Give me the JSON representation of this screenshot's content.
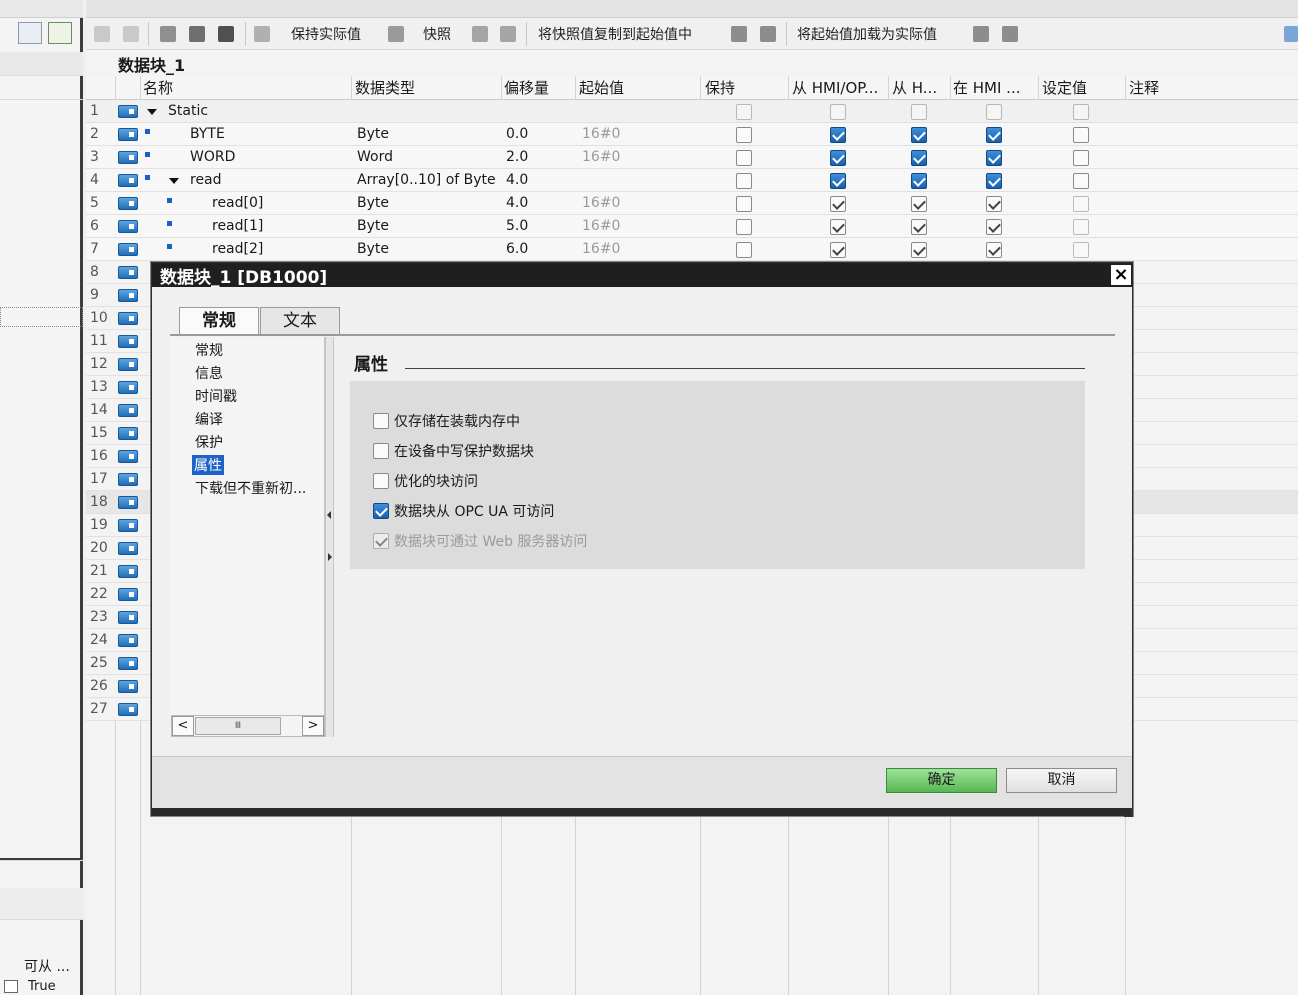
{
  "left_panel": {
    "column_label": "可从 ...",
    "value": "True"
  },
  "toolbar": {
    "keep_actual": "保持实际值",
    "snapshot": "快照",
    "copy_snapshot": "将快照值复制到起始值中",
    "load_start": "将起始值加载为实际值"
  },
  "block": {
    "title": "数据块_1"
  },
  "columns": [
    "名称",
    "数据类型",
    "偏移量",
    "起始值",
    "保持",
    "从 HMI/OP...",
    "从 H...",
    "在 HMI ...",
    "设定值",
    "注释"
  ],
  "rows": [
    {
      "num": "1",
      "name": "Static",
      "type": "",
      "offset": "",
      "start": ""
    },
    {
      "num": "2",
      "name": "BYTE",
      "type": "Byte",
      "offset": "0.0",
      "start": "16#0"
    },
    {
      "num": "3",
      "name": "WORD",
      "type": "Word",
      "offset": "2.0",
      "start": "16#0"
    },
    {
      "num": "4",
      "name": "read",
      "type": "Array[0..10] of Byte",
      "offset": "4.0",
      "start": ""
    },
    {
      "num": "5",
      "name": "read[0]",
      "type": "Byte",
      "offset": "4.0",
      "start": "16#0"
    },
    {
      "num": "6",
      "name": "read[1]",
      "type": "Byte",
      "offset": "5.0",
      "start": "16#0"
    },
    {
      "num": "7",
      "name": "read[2]",
      "type": "Byte",
      "offset": "6.0",
      "start": "16#0"
    }
  ],
  "more_rows": [
    "8",
    "9",
    "10",
    "11",
    "12",
    "13",
    "14",
    "15",
    "16",
    "17",
    "18",
    "19",
    "20",
    "21",
    "22",
    "23",
    "24",
    "25",
    "26",
    "27"
  ],
  "dialog": {
    "title": "数据块_1 [DB1000]",
    "close": "×",
    "tabs": [
      "常规",
      "文本"
    ],
    "nav": [
      "常规",
      "信息",
      "时间戳",
      "编译",
      "保护",
      "属性",
      "下载但不重新初..."
    ],
    "section_heading": "属性",
    "options": [
      {
        "label": "仅存储在装载内存中",
        "checked": false,
        "enabled": true
      },
      {
        "label": "在设备中写保护数据块",
        "checked": false,
        "enabled": true
      },
      {
        "label": "优化的块访问",
        "checked": false,
        "enabled": true
      },
      {
        "label": "数据块从 OPC UA 可访问",
        "checked": true,
        "enabled": true
      },
      {
        "label": "数据块可通过 Web 服务器访问",
        "checked": true,
        "enabled": false
      }
    ],
    "scroll_left": "<",
    "scroll_right": ">",
    "scroll_thumb": "Ⅲ",
    "ok": "确定",
    "cancel": "取消"
  },
  "colors": {
    "ok_button": "#57b652",
    "checkbox_checked": "#1a5fb0",
    "nav_selected": "#1e63c8",
    "dialog_titlebar": "#1f1f1f"
  }
}
